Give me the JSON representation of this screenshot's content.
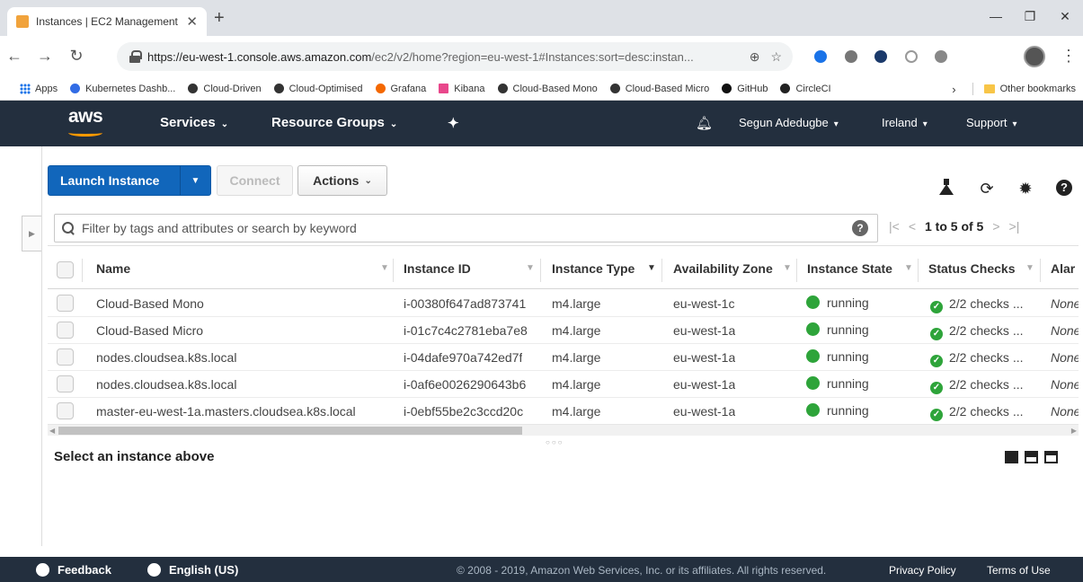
{
  "browser": {
    "tab_title": "Instances | EC2 Management C",
    "url_host": "https://eu-west-1.console.aws.amazon.com",
    "url_path": "/ec2/v2/home?region=eu-west-1#Instances:sort=desc:instan...",
    "bookmarks": [
      "Apps",
      "Kubernetes Dashb...",
      "Cloud-Driven",
      "Cloud-Optimised",
      "Grafana",
      "Kibana",
      "Cloud-Based Mono",
      "Cloud-Based Micro",
      "GitHub",
      "CircleCI"
    ],
    "other_bookmarks": "Other bookmarks"
  },
  "aws_nav": {
    "logo": "aws",
    "services": "Services",
    "resource_groups": "Resource Groups",
    "user": "Segun Adedugbe",
    "region": "Ireland",
    "support": "Support"
  },
  "toolbar": {
    "launch_label": "Launch Instance",
    "connect_label": "Connect",
    "actions_label": "Actions"
  },
  "filter": {
    "placeholder": "Filter by tags and attributes or search by keyword",
    "pager": "1 to 5 of 5"
  },
  "table": {
    "headers": [
      "Name",
      "Instance ID",
      "Instance Type",
      "Availability Zone",
      "Instance State",
      "Status Checks",
      "Alar"
    ],
    "rows": [
      {
        "name": "Cloud-Based Mono",
        "id": "i-00380f647ad873741",
        "type": "m4.large",
        "az": "eu-west-1c",
        "state": "running",
        "checks": "2/2 checks ...",
        "alarm": "None"
      },
      {
        "name": "Cloud-Based Micro",
        "id": "i-01c7c4c2781eba7e8",
        "type": "m4.large",
        "az": "eu-west-1a",
        "state": "running",
        "checks": "2/2 checks ...",
        "alarm": "None"
      },
      {
        "name": "nodes.cloudsea.k8s.local",
        "id": "i-04dafe970a742ed7f",
        "type": "m4.large",
        "az": "eu-west-1a",
        "state": "running",
        "checks": "2/2 checks ...",
        "alarm": "None"
      },
      {
        "name": "nodes.cloudsea.k8s.local",
        "id": "i-0af6e0026290643b6",
        "type": "m4.large",
        "az": "eu-west-1a",
        "state": "running",
        "checks": "2/2 checks ...",
        "alarm": "None"
      },
      {
        "name": "master-eu-west-1a.masters.cloudsea.k8s.local",
        "id": "i-0ebf55be2c3ccd20c",
        "type": "m4.large",
        "az": "eu-west-1a",
        "state": "running",
        "checks": "2/2 checks ...",
        "alarm": "None"
      }
    ]
  },
  "detail": {
    "title": "Select an instance above"
  },
  "footer": {
    "feedback": "Feedback",
    "language": "English (US)",
    "copyright": "© 2008 - 2019, Amazon Web Services, Inc. or its affiliates. All rights reserved.",
    "privacy": "Privacy Policy",
    "terms": "Terms of Use"
  },
  "colors": {
    "aws_nav": "#232f3e",
    "launch_button": "#1166bb",
    "running": "#2ea43a",
    "aws_orange": "#ff9900"
  }
}
